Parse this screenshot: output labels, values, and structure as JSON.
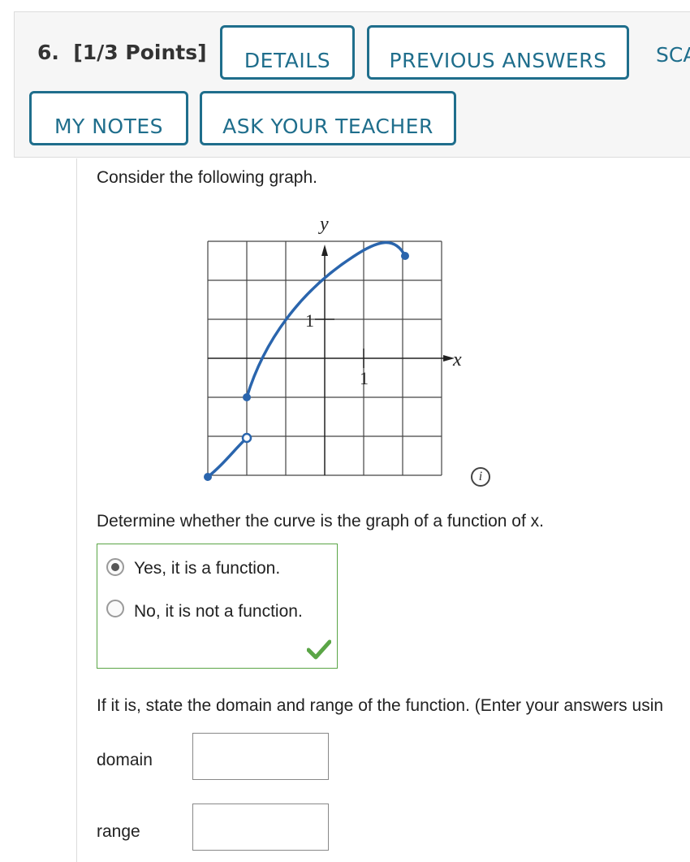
{
  "header": {
    "question_number": "6.",
    "points": "[1/3 Points]",
    "buttons": {
      "details": "DETAILS",
      "previous_answers": "PREVIOUS ANSWERS",
      "scalc": "SCA",
      "my_notes": "MY NOTES",
      "ask_teacher": "ASK YOUR TEACHER"
    }
  },
  "body": {
    "intro": "Consider the following graph.",
    "question1": "Determine whether the curve is the graph of a function of x.",
    "options": [
      {
        "label": "Yes, it is a function.",
        "selected": true
      },
      {
        "label": "No, it is not a function.",
        "selected": false
      }
    ],
    "result_icon": "checkmark-icon",
    "question2": "If it is, state the domain and range of the function. (Enter your answers usin",
    "domain_label": "domain",
    "domain_value": "",
    "range_label": "range",
    "range_value": ""
  },
  "graph": {
    "x_axis_label": "x",
    "y_axis_label": "y",
    "x_tick_label": "1",
    "y_tick_label": "1",
    "curve_color": "#2a65ad"
  },
  "icons": {
    "info": "i"
  },
  "colors": {
    "button_border": "#1f6e8c",
    "correct_border": "#5aa546"
  }
}
